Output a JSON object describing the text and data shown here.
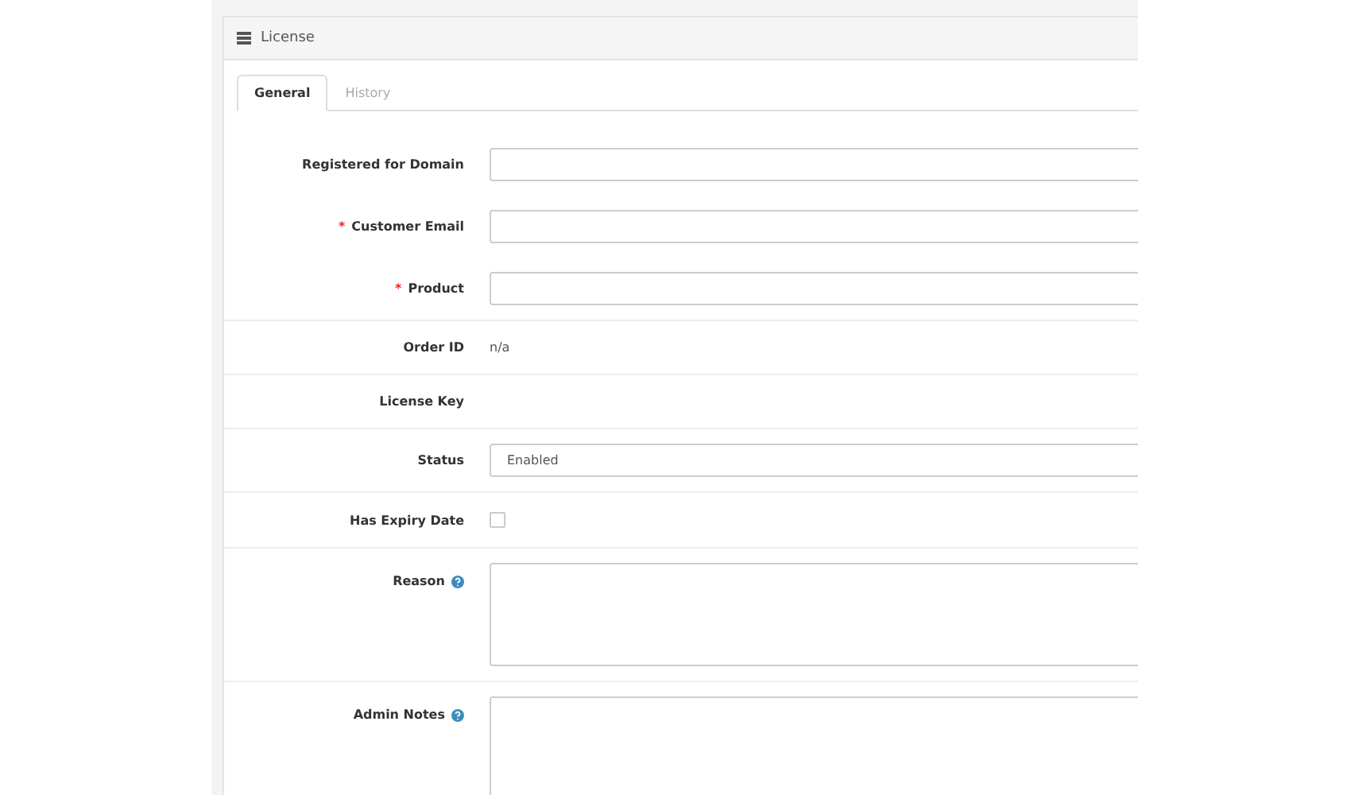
{
  "panel": {
    "title": "License"
  },
  "tabs": [
    {
      "label": "General",
      "selected": true
    },
    {
      "label": "History",
      "selected": false
    }
  ],
  "fields": [
    {
      "kind": "input",
      "label": "Registered for Domain"
    },
    {
      "kind": "input",
      "label": "Customer Email",
      "required_mark": "*"
    },
    {
      "kind": "input",
      "label": "Product",
      "required_mark": "*"
    },
    {
      "kind": "text",
      "label": "Order ID",
      "value": "n/a"
    },
    {
      "kind": "text",
      "label": "License Key"
    },
    {
      "kind": "select",
      "label": "Status",
      "value": "Enabled"
    },
    {
      "kind": "checkbox",
      "label": "Has Expiry Date",
      "checked": false
    },
    {
      "kind": "textarea",
      "label": "Reason",
      "help": true
    },
    {
      "kind": "textarea",
      "label": "Admin Notes",
      "help": true
    }
  ]
}
